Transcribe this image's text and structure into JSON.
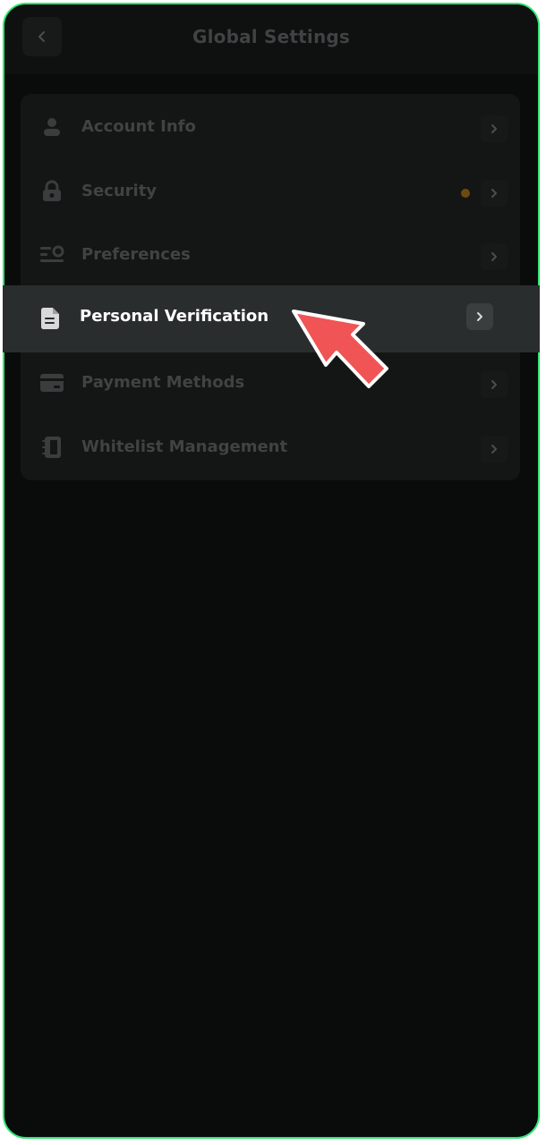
{
  "header": {
    "title": "Global Settings"
  },
  "menu": {
    "items": [
      {
        "label": "Account Info",
        "icon": "user-icon"
      },
      {
        "label": "Security",
        "icon": "lock-icon",
        "badge_color": "#6f4a10"
      },
      {
        "label": "Preferences",
        "icon": "preferences-icon"
      },
      {
        "label": "Personal Verification",
        "icon": "document-icon",
        "active": true
      },
      {
        "label": "Payment Methods",
        "icon": "card-icon"
      },
      {
        "label": "Whitelist Management",
        "icon": "notebook-icon"
      }
    ]
  },
  "colors": {
    "frame_border": "#2ee672",
    "background": "#0a0b0b",
    "dim_text": "#3f4343",
    "active_text": "#ffffff",
    "pointer_arrow": "#f05454"
  }
}
